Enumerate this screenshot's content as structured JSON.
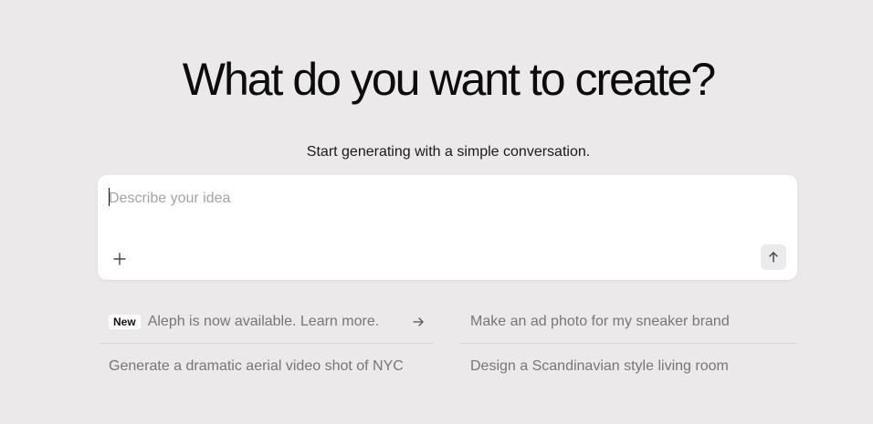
{
  "hero": {
    "title": "What do you want to create?",
    "subtitle": "Start generating with a simple conversation."
  },
  "composer": {
    "placeholder": "Describe your idea",
    "value": "",
    "add_icon": "plus-icon",
    "send_icon": "arrow-up-icon"
  },
  "suggestions": [
    {
      "badge": "New",
      "text": "Aleph is now available. Learn more.",
      "icon": "arrow-right-icon"
    },
    {
      "text": "Make an ad photo for my sneaker brand"
    },
    {
      "text": "Generate a dramatic aerial video shot of NYC"
    },
    {
      "text": "Design a Scandinavian style living room"
    }
  ],
  "colors": {
    "background": "#ebe9ea",
    "card": "#ffffff",
    "muted_text": "#76767b",
    "placeholder": "#a3a3a8"
  }
}
